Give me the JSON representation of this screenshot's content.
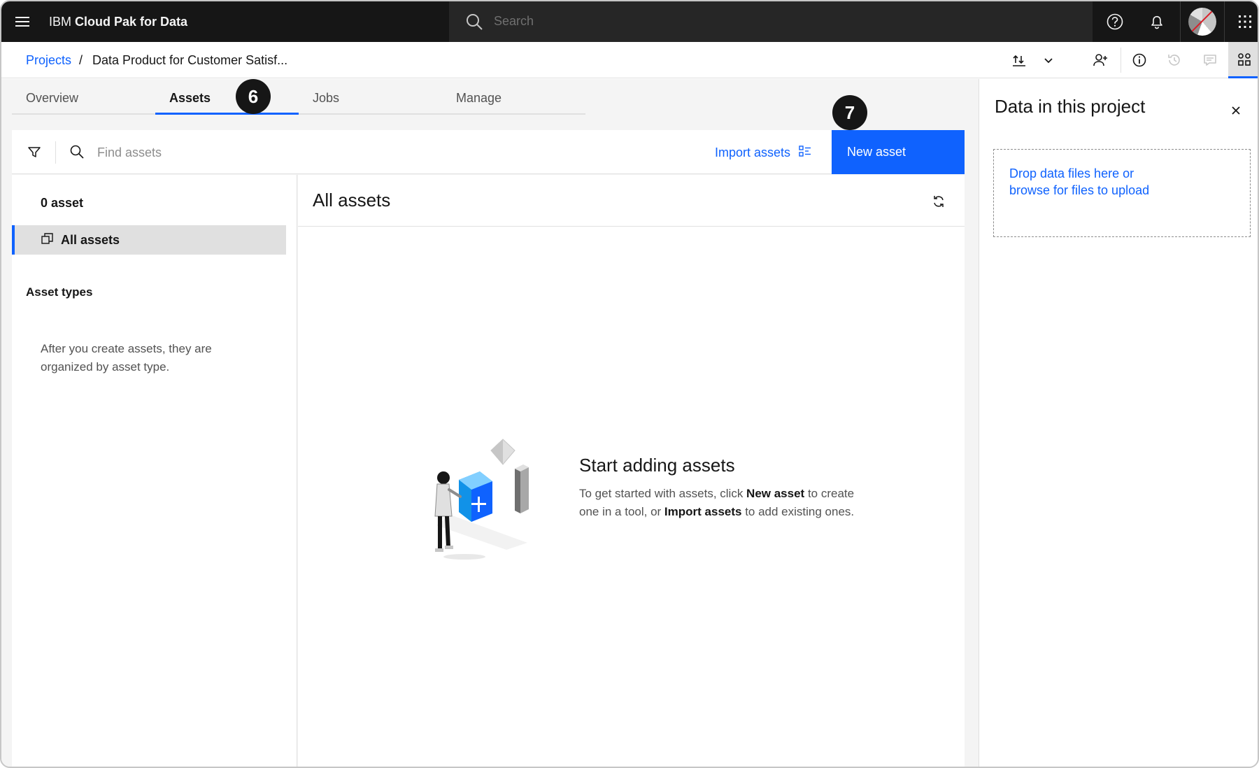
{
  "app": {
    "brand_prefix": "IBM ",
    "brand_name": "Cloud Pak for Data",
    "search_placeholder": "Search"
  },
  "breadcrumb": {
    "root": "Projects",
    "separator": "/",
    "current": "Data Product for Customer Satisf..."
  },
  "tabs": [
    {
      "label": "Overview"
    },
    {
      "label": "Assets"
    },
    {
      "label": "Jobs"
    },
    {
      "label": "Manage"
    }
  ],
  "badges": {
    "step_6": "6",
    "step_7": "7"
  },
  "toolbar": {
    "find_placeholder": "Find assets",
    "import_label": "Import assets",
    "new_asset_label": "New asset"
  },
  "left_panel": {
    "asset_count": "0 asset",
    "all_assets_label": "All assets",
    "asset_types_heading": "Asset types",
    "asset_types_note": "After you create assets, they are organized by asset type."
  },
  "content": {
    "title": "All assets",
    "empty_title": "Start adding assets",
    "empty_body": {
      "part1": "To get started with assets, click ",
      "bold1": "New asset",
      "part2": " to create one in a tool, or ",
      "bold2": "Import assets",
      "part3": " to add existing ones."
    }
  },
  "side_panel": {
    "title": "Data in this project",
    "dropzone_text": "Drop data files here or browse for files to upload"
  },
  "colors": {
    "primary": "#0f62fe",
    "header_bg": "#161616",
    "surface": "#f4f4f4"
  }
}
